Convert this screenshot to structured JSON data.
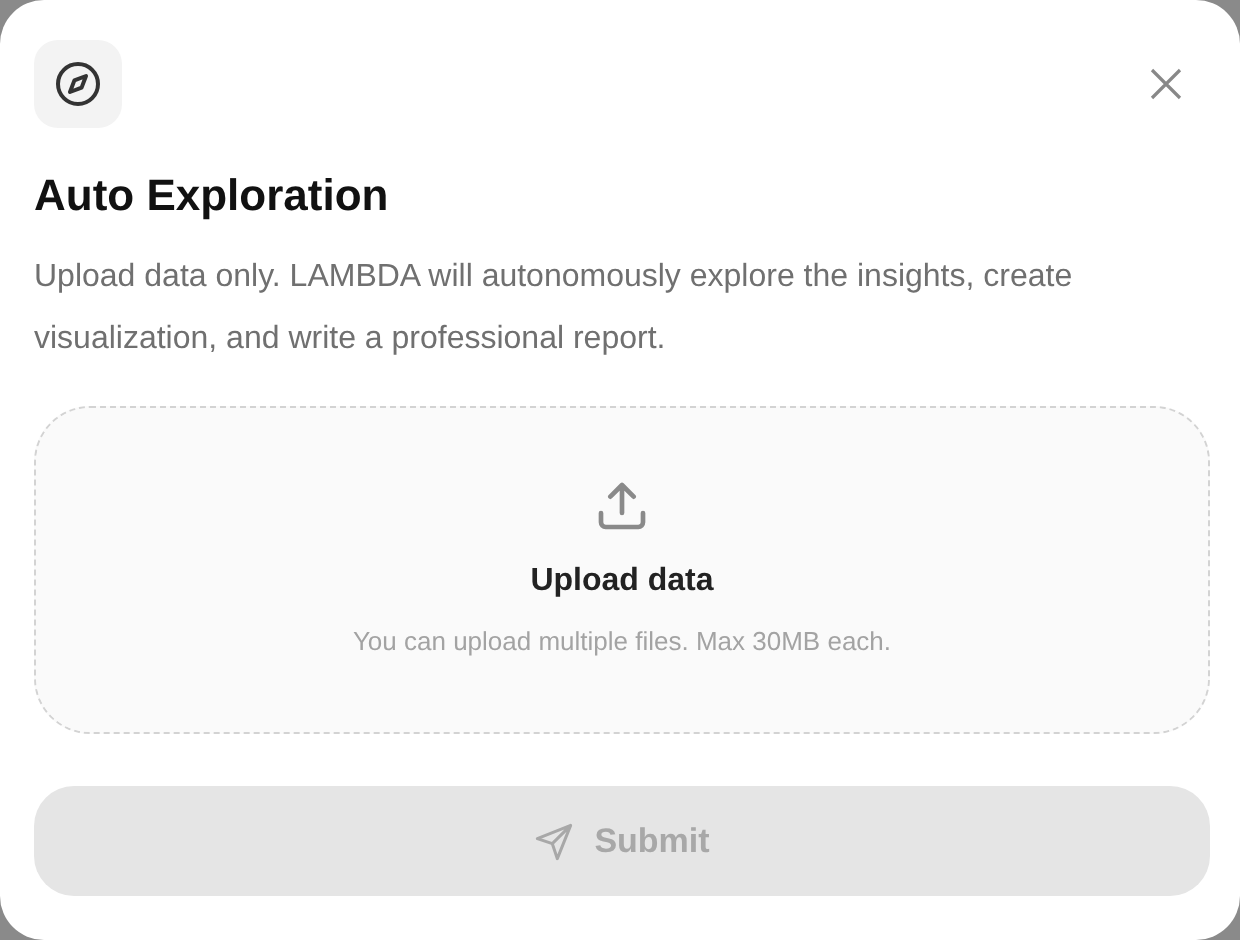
{
  "dialog": {
    "title": "Auto Exploration",
    "description": "Upload data only. LAMBDA will autonomously explore the insights, create visualization, and write a professional report."
  },
  "upload": {
    "title": "Upload data",
    "hint": "You can upload multiple files. Max 30MB each."
  },
  "submit": {
    "label": "Submit",
    "disabled": true
  }
}
